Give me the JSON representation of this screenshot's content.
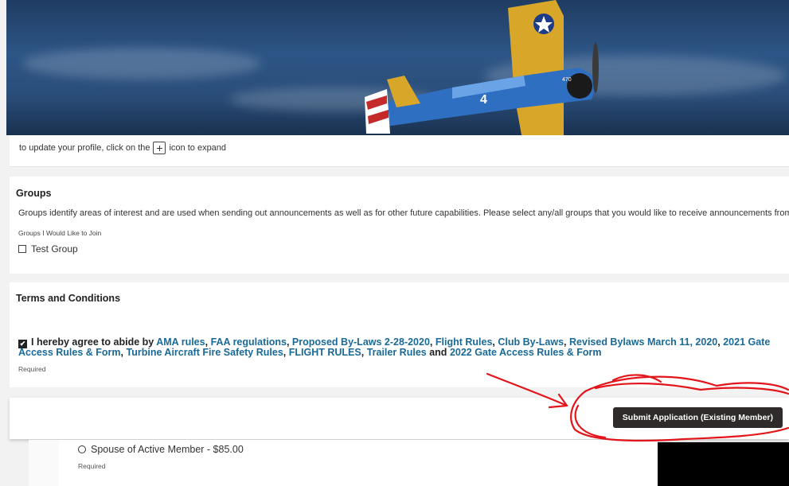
{
  "profile_hint": {
    "text_before": "to update your profile, click on the",
    "text_after": "icon to expand",
    "icon_glyph": "+"
  },
  "groups": {
    "title": "Groups",
    "description": "Groups identify areas of interest and are used when sending out announcements as well as for other future capabilities. Please select any/all groups that you would like to receive announcements from.",
    "label": "Groups I Would Like to Join",
    "options": [
      "Test Group"
    ]
  },
  "terms": {
    "title": "Terms and Conditions",
    "intro": "I hereby agree to abide by",
    "links": {
      "ama": "AMA rules",
      "faa": "FAA regulations",
      "bylaws_proposed": "Proposed By-Laws 2-28-2020",
      "flight_rules": "Flight Rules",
      "club_bylaws": "Club By-Laws",
      "revised_bylaws": "Revised Bylaws March 11, 2020",
      "gate_2021": "2021 Gate Access Rules & Form",
      "turbine": "Turbine Aircraft Fire Safety Rules",
      "flight_rules_caps": "FLIGHT RULES",
      "trailer": "Trailer Rules",
      "gate_2022": "2022 Gate Access Rules & Form"
    },
    "sep": ",",
    "and": "and",
    "required": "Required"
  },
  "submit": {
    "label": "Submit Application (Existing Member)"
  },
  "membership": {
    "option": "Spouse of Active Member - $85.00",
    "required": "Required"
  },
  "colors": {
    "link": "#1a6a97",
    "button": "#2f2b2a",
    "annotation": "#e3151a"
  }
}
